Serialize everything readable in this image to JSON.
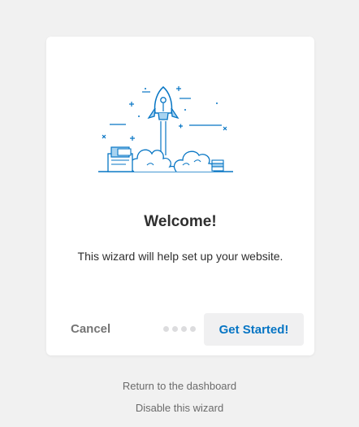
{
  "welcome": {
    "title": "Welcome!",
    "description": "This wizard will help set up your website."
  },
  "footer": {
    "cancel_label": "Cancel",
    "primary_label": "Get Started!",
    "progress": {
      "total_steps": 4,
      "current_step": 0
    }
  },
  "links": {
    "dashboard": "Return to the dashboard",
    "disable": "Disable this wizard"
  },
  "colors": {
    "accent": "#0675c4",
    "background": "#f1f1f1",
    "card": "#ffffff",
    "muted_text": "#757575"
  },
  "icons": {
    "illustration": "rocket-launch-illustration"
  }
}
